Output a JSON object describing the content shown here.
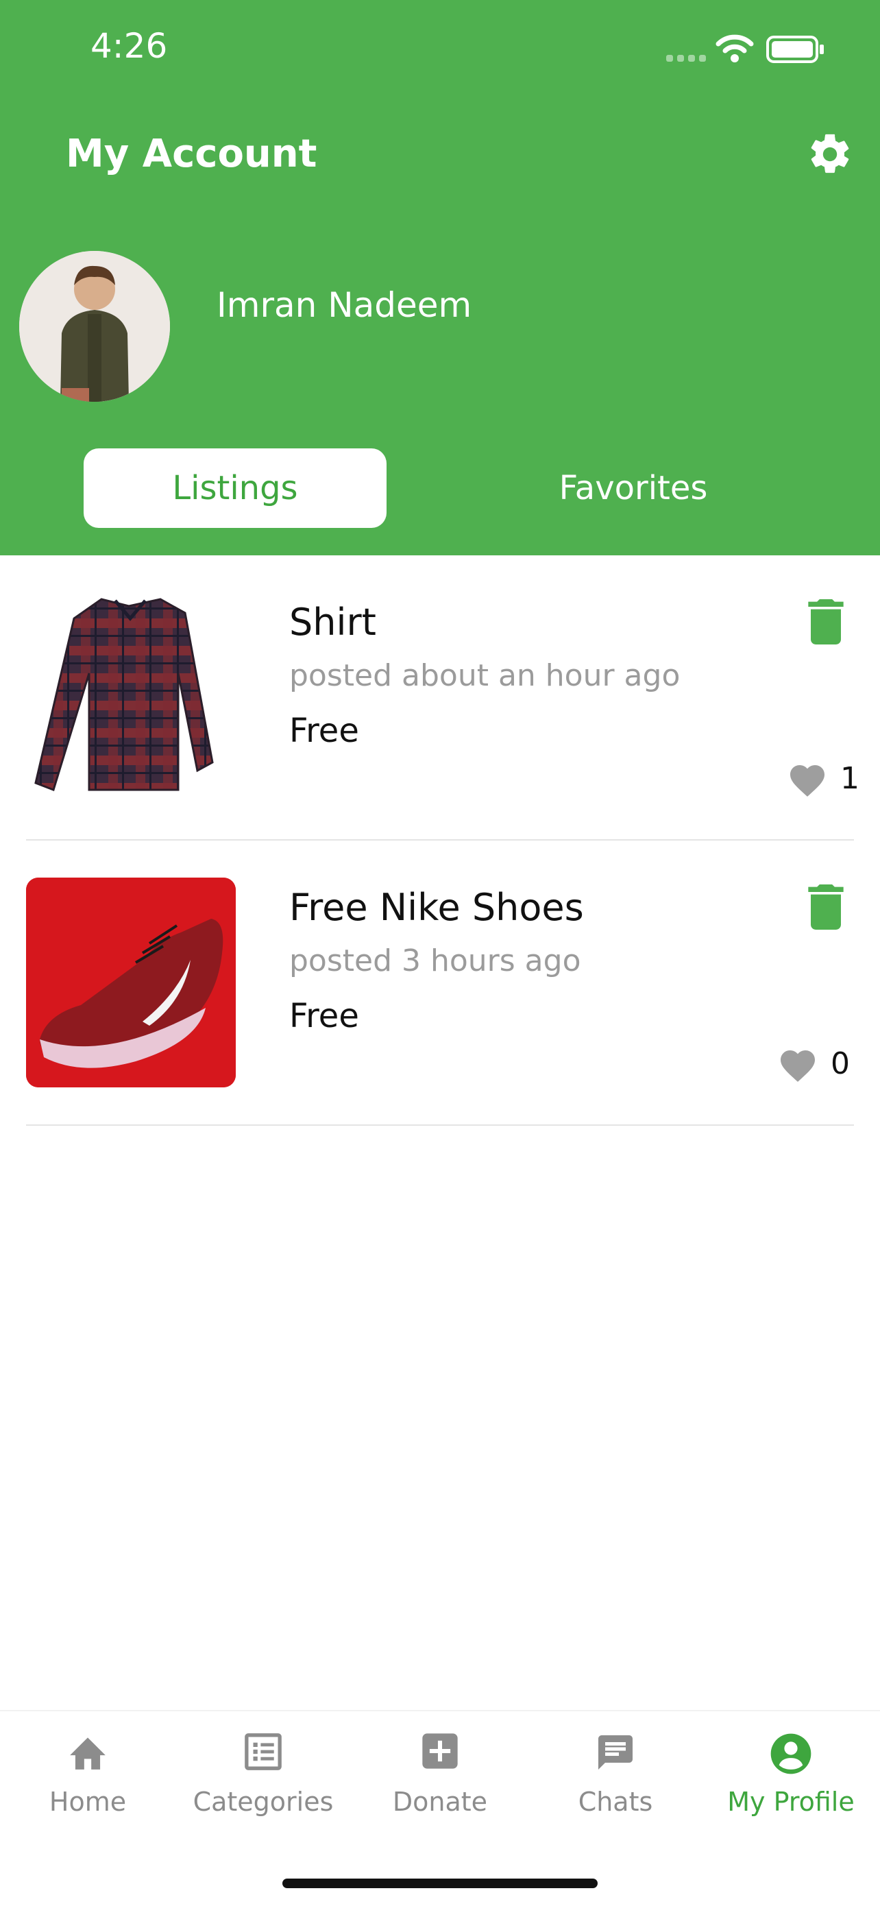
{
  "status_bar": {
    "time": "4:26"
  },
  "header": {
    "title": "My Account",
    "settings_icon": "gear-icon"
  },
  "profile": {
    "name": "Imran Nadeem"
  },
  "tabs": {
    "listings": "Listings",
    "favorites": "Favorites",
    "active": "Listings"
  },
  "listings": [
    {
      "title": "Shirt",
      "posted": "posted about an hour ago",
      "price": "Free",
      "likes": "1"
    },
    {
      "title": "Free Nike Shoes",
      "posted": "posted 3 hours ago",
      "price": "Free",
      "likes": "0"
    }
  ],
  "tabbar": {
    "items": [
      {
        "label": "Home",
        "icon": "home-icon"
      },
      {
        "label": "Categories",
        "icon": "list-icon"
      },
      {
        "label": "Donate",
        "icon": "plus-square-icon"
      },
      {
        "label": "Chats",
        "icon": "chat-icon"
      },
      {
        "label": "My Profile",
        "icon": "profile-icon"
      }
    ],
    "active": "My Profile"
  },
  "colors": {
    "primary": "#4fb04f",
    "active_text": "#3ea63e",
    "muted": "#8c8c8c"
  }
}
